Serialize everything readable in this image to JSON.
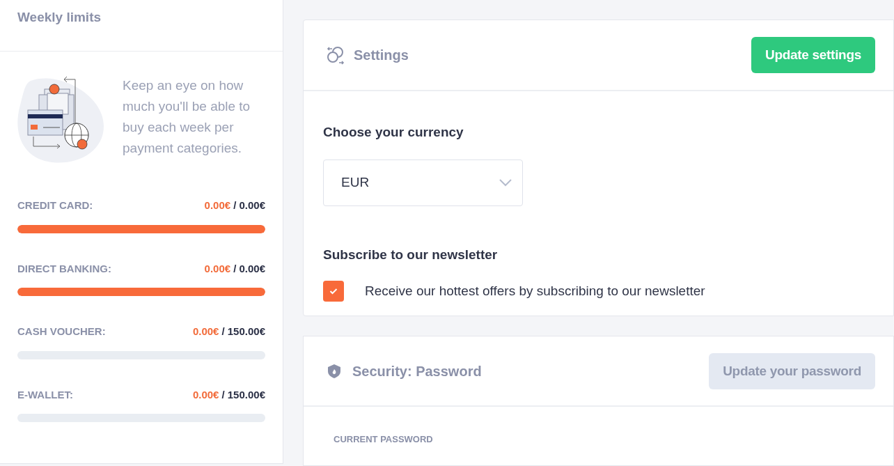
{
  "weekly_limits": {
    "title": "Weekly limits",
    "description": "Keep an eye on how much you'll be able to buy each week per payment categories.",
    "limits": [
      {
        "label": "CREDIT CARD:",
        "used": "0.00€",
        "total": "/ 0.00€",
        "level": 1
      },
      {
        "label": "DIRECT BANKING:",
        "used": "0.00€",
        "total": "/ 0.00€",
        "level": 1
      },
      {
        "label": "CASH VOUCHER:",
        "used": "0.00€",
        "total": "/ 150.00€",
        "level": 0
      },
      {
        "label": "E-WALLET:",
        "used": "0.00€",
        "total": "/ 150.00€",
        "level": 0
      }
    ]
  },
  "settings": {
    "title": "Settings",
    "button": {
      "label": "Update settings",
      "disabled": false
    },
    "currency": {
      "heading": "Choose your currency",
      "value": "EUR"
    },
    "newsletter": {
      "heading": "Subscribe to our newsletter",
      "label": "Receive our hottest offers by subscribing to our newsletter",
      "checked": true
    }
  },
  "security": {
    "title": "Security: Password",
    "button": {
      "label": "Update your password",
      "disabled": true
    },
    "fields": [
      {
        "label": "CURRENT PASSWORD"
      }
    ]
  }
}
